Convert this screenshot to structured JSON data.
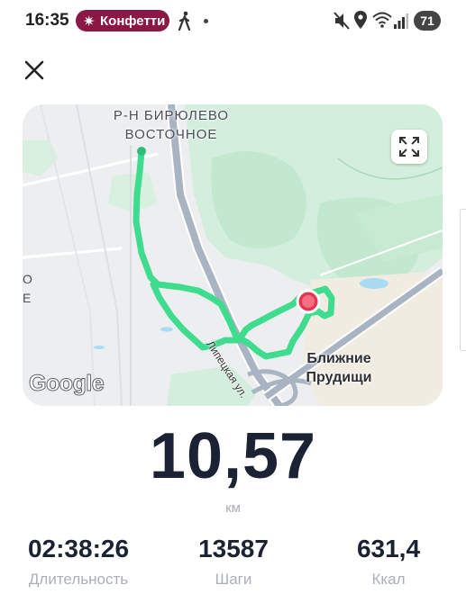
{
  "status_bar": {
    "time": "16:35",
    "notification_app": "Конфетти",
    "battery": "71"
  },
  "map": {
    "district_label": "Р-Н БИРЮЛЕВО\nВОСТОЧНОЕ",
    "place_label": "Ближние\nПрудищи",
    "road_label": "Липецкая ул.",
    "edge_label": "О\nЕ",
    "google_logo": "Google"
  },
  "workout": {
    "distance_value": "10,57",
    "distance_unit": "км",
    "duration_value": "02:38:26",
    "duration_label": "Длительность",
    "steps_value": "13587",
    "steps_label": "Шаги",
    "kcal_value": "631,4",
    "kcal_label": "Ккал"
  },
  "colors": {
    "route": "#3fdc8f",
    "notification_pill": "#8b1744",
    "end_marker": "#e8344e",
    "stat_label": "#a9b0ba"
  },
  "icons": [
    "sparkle-icon",
    "walking-icon",
    "mute-icon",
    "location-icon",
    "wifi-icon",
    "signal-icon",
    "close-icon",
    "expand-icon"
  ]
}
